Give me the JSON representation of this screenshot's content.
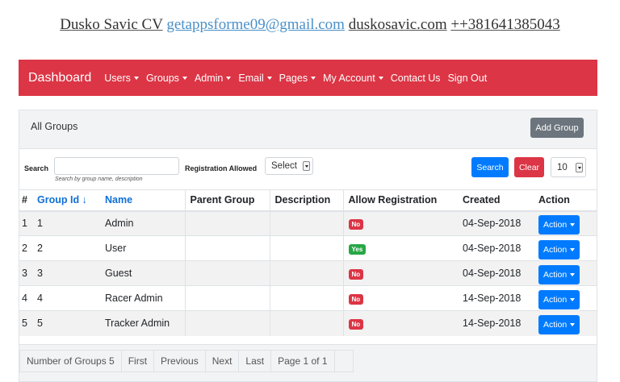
{
  "cv": {
    "name": "Dusko Savic CV",
    "email": "getappsforme09@gmail.com",
    "site": "duskosavic.com",
    "phone": "++381641385043"
  },
  "nav": {
    "brand": "Dashboard",
    "items": [
      {
        "label": "Users",
        "dropdown": true
      },
      {
        "label": "Groups",
        "dropdown": true
      },
      {
        "label": "Admin",
        "dropdown": true
      },
      {
        "label": "Email",
        "dropdown": true
      },
      {
        "label": "Pages",
        "dropdown": true
      },
      {
        "label": "My Account",
        "dropdown": true
      },
      {
        "label": "Contact Us",
        "dropdown": false
      },
      {
        "label": "Sign Out",
        "dropdown": false
      }
    ]
  },
  "card": {
    "title": "All Groups",
    "add_button": "Add Group"
  },
  "filters": {
    "search_label": "Search",
    "search_value": "",
    "search_hint": "Search by group name, description",
    "registration_label": "Registration Allowed",
    "registration_value": "Select",
    "search_button": "Search",
    "clear_button": "Clear",
    "page_size": "10"
  },
  "table": {
    "headers": [
      "#",
      "Group Id ↓",
      "Name",
      "Parent Group",
      "Description",
      "Allow Registration",
      "Created",
      "Action"
    ],
    "rows": [
      {
        "num": "1",
        "id": "1",
        "name": "Admin",
        "parent": "",
        "description": "",
        "allow": "No",
        "created": "04-Sep-2018",
        "action": "Action"
      },
      {
        "num": "2",
        "id": "2",
        "name": "User",
        "parent": "",
        "description": "",
        "allow": "Yes",
        "created": "04-Sep-2018",
        "action": "Action"
      },
      {
        "num": "3",
        "id": "3",
        "name": "Guest",
        "parent": "",
        "description": "",
        "allow": "No",
        "created": "04-Sep-2018",
        "action": "Action"
      },
      {
        "num": "4",
        "id": "4",
        "name": "Racer Admin",
        "parent": "",
        "description": "",
        "allow": "No",
        "created": "14-Sep-2018",
        "action": "Action"
      },
      {
        "num": "5",
        "id": "5",
        "name": "Tracker Admin",
        "parent": "",
        "description": "",
        "allow": "No",
        "created": "14-Sep-2018",
        "action": "Action"
      }
    ]
  },
  "pager": {
    "count": "Number of Groups 5",
    "first": "First",
    "previous": "Previous",
    "next": "Next",
    "last": "Last",
    "page": "Page 1 of 1"
  },
  "colors": {
    "navbar": "#dc3545",
    "primary": "#007bff",
    "secondary": "#6c757d",
    "success": "#28a745"
  }
}
